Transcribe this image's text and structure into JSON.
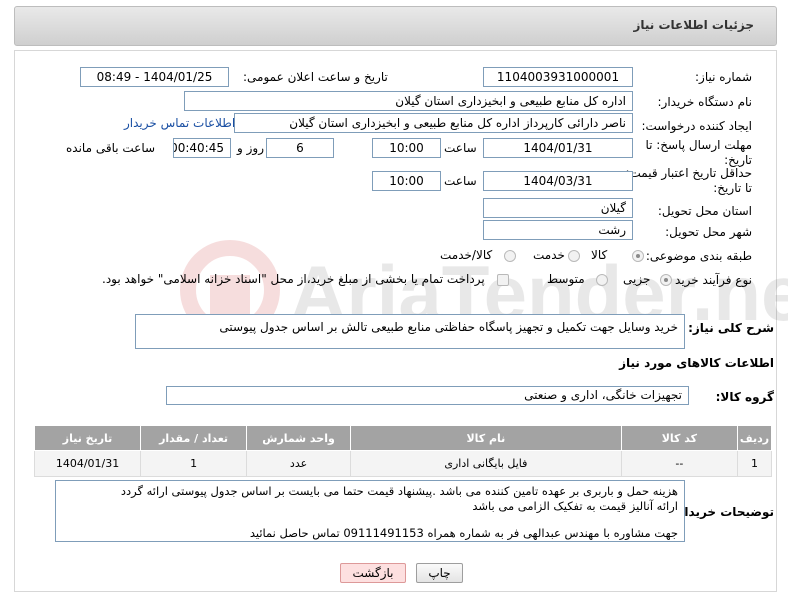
{
  "header": {
    "title": "جزئیات اطلاعات نیاز"
  },
  "fields": {
    "need_number_label": "شماره نیاز:",
    "need_number": "1104003931000001",
    "announce_label": "تاریخ و ساعت اعلان عمومی:",
    "announce_value": "1404/01/25 - 08:49",
    "buyer_org_label": "نام دستگاه خریدار:",
    "buyer_org": "اداره کل منابع طبیعی و ابخیزداری استان گیلان",
    "creator_label": "ایجاد کننده درخواست:",
    "creator": "ناصر  دارائی کارپرداز اداره کل منابع طبیعی و ابخیزداری استان گیلان",
    "contact_link": "اطلاعات تماس خریدار",
    "reply_deadline_label_1": "مهلت ارسال پاسخ: تا",
    "reply_deadline_label_2": "تاریخ:",
    "reply_date": "1404/01/31",
    "time_label": "ساعت",
    "reply_time": "10:00",
    "days_value": "6",
    "days_label": "روز و",
    "remaining_time": "00:40:45",
    "remaining_label": "ساعت باقی مانده",
    "validity_label_1": "حداقل تاریخ اعتبار قیمت:",
    "validity_label_2": "تا تاریخ:",
    "validity_date": "1404/03/31",
    "validity_time": "10:00",
    "province_label": "استان محل تحویل:",
    "province": "گیلان",
    "city_label": "شهر محل تحویل:",
    "city": "رشت",
    "category_label": "طبقه بندی موضوعی:",
    "category_options": [
      "کالا",
      "خدمت",
      "کالا/خدمت"
    ],
    "process_label": "نوع فرآیند خرید :",
    "process_options": [
      "جزیی",
      "متوسط"
    ],
    "payment_note": "پرداخت تمام یا بخشی از مبلغ خرید،از محل \"اسناد خزانه اسلامی\" خواهد بود.",
    "description_label": "شرح کلی نیاز:",
    "description": "خرید وسایل جهت تکمیل و  تجهیز پاسگاه حفاظتی منابع طبیعی تالش بر اساس جدول پیوستی",
    "goods_info_title": "اطلاعات کالاهای مورد نیاز",
    "goods_group_label": "گروه کالا:",
    "goods_group": "تجهیزات خانگی، اداری و صنعتی"
  },
  "table": {
    "headers": [
      "ردیف",
      "کد کالا",
      "نام کالا",
      "واحد شمارش",
      "تعداد / مقدار",
      "تاریخ نیاز"
    ],
    "rows": [
      [
        "1",
        "--",
        "فایل بایگانی اداری",
        "عدد",
        "1",
        "1404/01/31"
      ]
    ]
  },
  "notes": {
    "label": "توضیحات خریدار:",
    "line1": "هزینه حمل و باربری بر عهده تامین کننده می باشد .پیشنهاد قیمت حتما می بایست بر اساس جدول پیوستی ارائه گردد",
    "line2": "ارائه آنالیز قیمت به تفکیک الزامی می باشد",
    "line3": "جهت مشاوره با مهندس عبدالهی فر به شماره همراه 09111491153 تماس حاصل نمائید"
  },
  "buttons": {
    "print": "چاپ",
    "back": "بازگشت"
  },
  "watermark": {
    "text": "AriaTender.neT"
  }
}
